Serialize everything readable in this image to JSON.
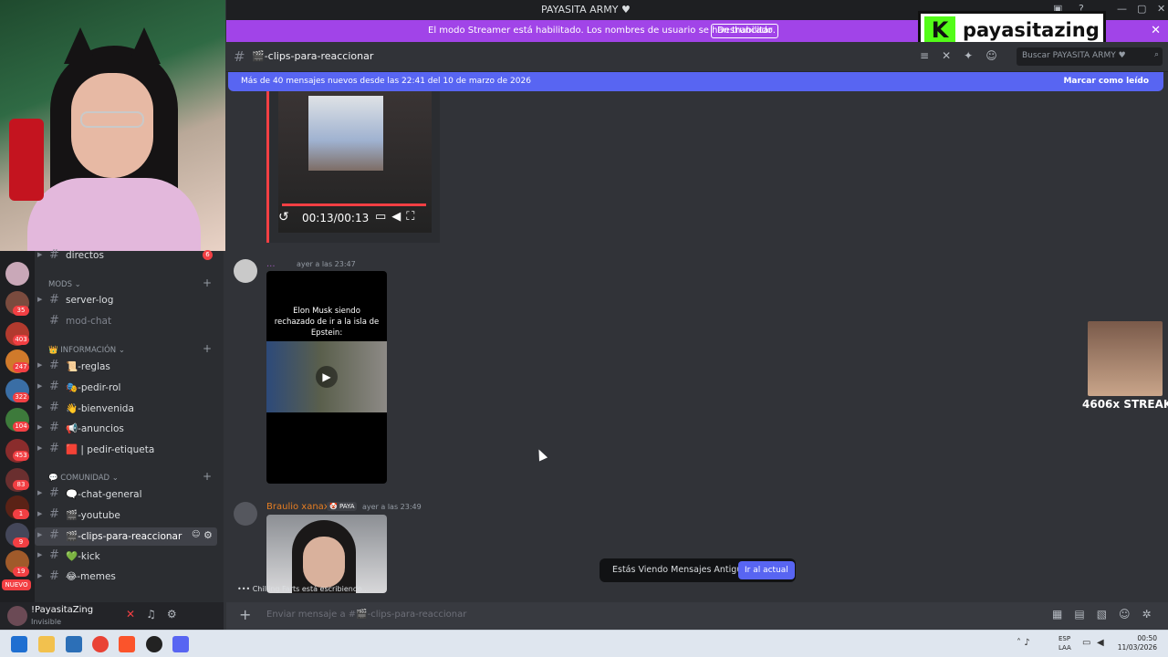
{
  "window": {
    "title": "PAYASITA ARMY ♥"
  },
  "streamer_mode": {
    "message": "El modo Streamer está habilitado. Los nombres de usuario se han truncado.",
    "button": "Deshabilitar"
  },
  "logo": {
    "text": "payasitazing",
    "letter": "K"
  },
  "channel_header": {
    "name": "🎬-clips-para-reaccionar",
    "search_placeholder": "Buscar PAYASITA ARMY ♥"
  },
  "new_messages_bar": {
    "text": "Más de 40 mensajes nuevos desde las 22:41 del 10 de marzo de 2026",
    "action": "Marcar como leído"
  },
  "sidebar": {
    "servers": [
      {
        "badge": ""
      },
      {
        "badge": "35"
      },
      {
        "badge": "403"
      },
      {
        "badge": "247"
      },
      {
        "badge": "322"
      },
      {
        "badge": "104"
      },
      {
        "badge": "453"
      },
      {
        "badge": "83"
      },
      {
        "badge": "1"
      },
      {
        "badge": "9"
      },
      {
        "badge": "19"
      }
    ],
    "nuevo_label": "NUEVO",
    "channels": [
      {
        "label": "directos",
        "badge": "6"
      },
      {
        "category": "MODS"
      },
      {
        "label": "server-log"
      },
      {
        "label": "mod-chat"
      },
      {
        "category": "👑 INFORMACIÓN"
      },
      {
        "label": "📜-reglas"
      },
      {
        "label": "🎭-pedir-rol"
      },
      {
        "label": "👋-bienvenida"
      },
      {
        "label": "📢-anuncios"
      },
      {
        "label": "🟥 | pedir-etiqueta"
      },
      {
        "category": "💬 COMUNIDAD"
      },
      {
        "label": "🗨️-chat-general"
      },
      {
        "label": "🎬-youtube"
      },
      {
        "label": "🎬-clips-para-reaccionar"
      },
      {
        "label": "💚-kick"
      },
      {
        "label": "😂-memes"
      }
    ]
  },
  "user": {
    "name": "!PayasitaZing",
    "status": "Invisible"
  },
  "messages": [
    {
      "video_time": "00:13/00:13"
    },
    {
      "author": "...",
      "timestamp": "ayer a las 23:47",
      "video_caption": "Elon Musk siendo rechazado de ir a la isla de Epstein:"
    },
    {
      "author": "Braulio xanax",
      "tag": "🤡 PAYA",
      "timestamp": "ayer a las 23:49"
    }
  ],
  "typing": {
    "text": "Chilling Farts está escribiendo..."
  },
  "old_messages": {
    "text": "Estás Viendo Mensajes Antiguos",
    "button": "Ir al actual"
  },
  "composer": {
    "placeholder": "Enviar mensaje a #🎬-clips-para-reaccionar"
  },
  "streak": {
    "text": "4606x STREAK"
  },
  "taskbar": {
    "lang": "ESP",
    "lang2": "LAA",
    "time": "00:50",
    "date": "11/03/2026"
  },
  "colors": {
    "accent": "#5865f2",
    "streamer": "#a144e8",
    "kick_green": "#53fc18"
  }
}
